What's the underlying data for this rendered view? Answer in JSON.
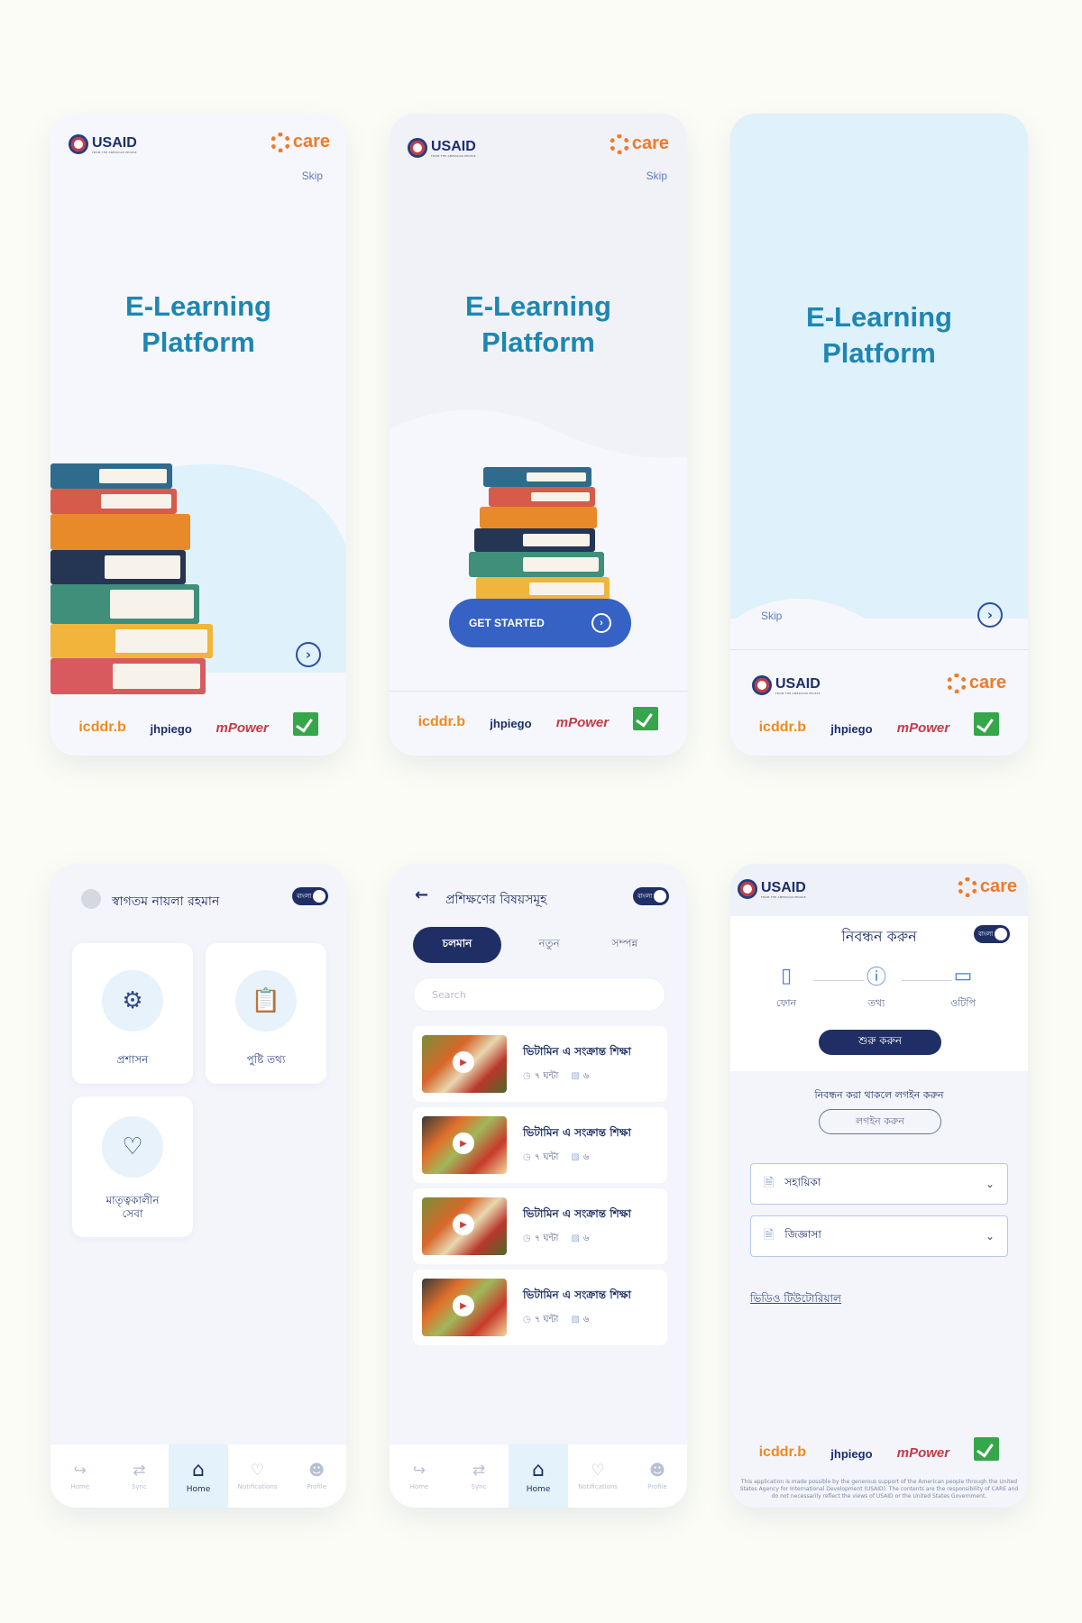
{
  "brand": {
    "usaid": "USAID",
    "usaid_sub": "FROM THE AMERICAN PEOPLE",
    "care": "care"
  },
  "splash": {
    "title_line1": "E-Learning",
    "title_line2": "Platform",
    "skip": "Skip",
    "get_started": "GET STARTED",
    "partners": [
      "icddr.b",
      "jhpiego",
      "mPower"
    ]
  },
  "home": {
    "greeting": "স্বাগতম নায়লা রহমান",
    "lang_toggle": "বাংলা",
    "tiles": [
      "প্রশাসন",
      "পুষ্টি তথ্য",
      "মাতৃত্বকালীন সেবা"
    ]
  },
  "nav": [
    "Home",
    "Sync",
    "Home",
    "Notifications",
    "Profile"
  ],
  "courses": {
    "header": "প্রশিক্ষণের বিষয়সমূহ",
    "tabs": [
      "চলমান",
      "নতুন",
      "সম্পন্ন"
    ],
    "search_placeholder": "Search",
    "items": [
      {
        "title": "ভিটামিন এ সংক্রান্ত শিক্ষা",
        "duration": "৭ ঘন্টা",
        "lessons": "৬"
      },
      {
        "title": "ভিটামিন এ সংক্রান্ত শিক্ষা",
        "duration": "৭ ঘন্টা",
        "lessons": "৬"
      },
      {
        "title": "ভিটামিন এ সংক্রান্ত শিক্ষা",
        "duration": "৭ ঘন্টা",
        "lessons": "৬"
      },
      {
        "title": "ভিটামিন এ সংক্রান্ত শিক্ষা",
        "duration": "৭ ঘন্টা",
        "lessons": "৬"
      }
    ]
  },
  "register": {
    "title": "নিবন্ধন করুন",
    "steps": [
      "ফোন",
      "তথ্য",
      "ওটিপি"
    ],
    "start": "শুরু করুন",
    "login_prompt": "নিবন্ধন করা থাকলে লগইন করুন",
    "login": "লগইন করুন",
    "accordion": [
      "সহায়িকা",
      "জিজ্ঞাসা"
    ],
    "video_link": "ভিডিও টিউটোরিয়াল",
    "disclaimer": "This application is made possible by the generous support of the American people through the United States Agency for International Development (USAID). The contents are the responsibility of CARE and do not necessarily reflect the views of USAID or the United States Government."
  },
  "colors": {
    "primary": "#1f2f66",
    "accent": "#3562c4",
    "title": "#1d86b3",
    "care": "#f07a2a",
    "bg": "#fbfcf5"
  }
}
